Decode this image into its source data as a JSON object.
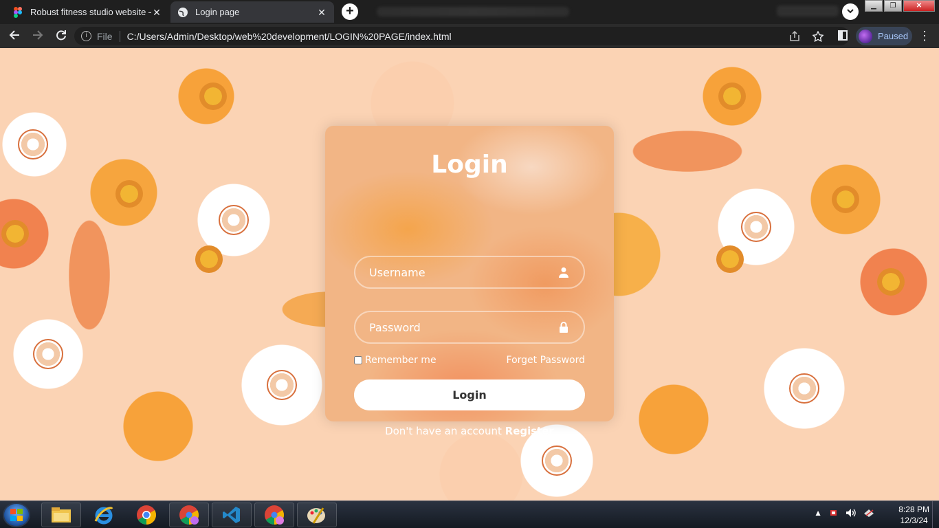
{
  "browser": {
    "tabs": [
      {
        "title": "Robust fitness studio website – Fi",
        "active": false,
        "close": "✕"
      },
      {
        "title": "Login page",
        "active": true,
        "close": "✕"
      }
    ],
    "new_tab": "+",
    "url_scheme": "File",
    "url": "C:/Users/Admin/Desktop/web%20development/LOGIN%20PAGE/index.html",
    "profile_status": "Paused",
    "icons": [
      "back-icon",
      "forward-icon",
      "reload-icon",
      "info-icon",
      "share-icon",
      "star-icon",
      "side-panel-icon",
      "menu-icon"
    ]
  },
  "page": {
    "title": "Login",
    "username_placeholder": "Username",
    "password_placeholder": "Password",
    "remember_label": "Remember me",
    "forget_link": "Forget Password",
    "login_button": "Login",
    "register_prompt": "Don't have an account",
    "register_link": "Register"
  },
  "taskbar": {
    "apps": [
      "file-explorer-icon",
      "internet-explorer-icon",
      "chrome-icon",
      "chrome-profile-icon",
      "vscode-icon",
      "chrome-profile-icon",
      "paint-icon"
    ],
    "time": "8:28 PM",
    "date": "12/3/24"
  },
  "colors": {
    "accent_orange": "#f7a23a",
    "card_tint": "#f2b585",
    "chrome_dark": "#2b2b2b"
  }
}
